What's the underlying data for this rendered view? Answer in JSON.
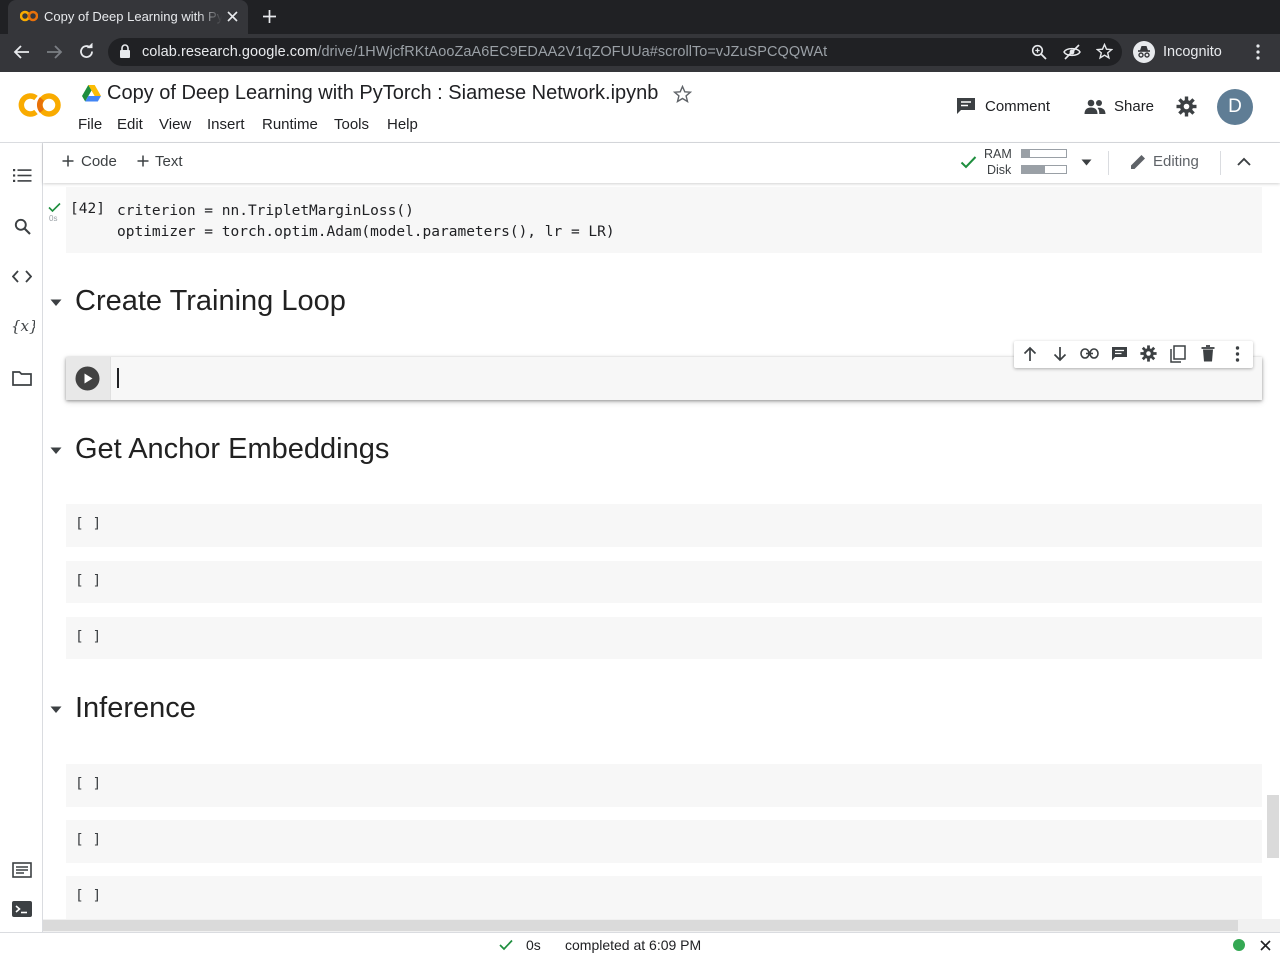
{
  "browser": {
    "tab_title": "Copy of Deep Learning with PyTorch : Siamese Network.ipynb",
    "url_host": "colab.research.google.com",
    "url_path": "/drive/1HWjcfRKtAooZaA6EC9EDAA2V1qZOFUUa#scrollTo=vJZuSPCQQWAt",
    "profile_label": "Incognito"
  },
  "colab": {
    "notebook_title": "Copy of Deep Learning with PyTorch : Siamese Network.ipynb",
    "menu": [
      "File",
      "Edit",
      "View",
      "Insert",
      "Runtime",
      "Tools",
      "Help"
    ],
    "comment_label": "Comment",
    "share_label": "Share",
    "avatar_letter": "D",
    "toolbar": {
      "add_code": "Code",
      "add_text": "Text",
      "ram_label": "RAM",
      "disk_label": "Disk",
      "ram_usage": 0.18,
      "disk_usage": 0.52,
      "editing_label": "Editing"
    }
  },
  "cells": {
    "c42": {
      "exec_count": "[42]",
      "exec_time": "0s",
      "code": "criterion = nn.TripletMarginLoss()\noptimizer = torch.optim.Adam(model.parameters(), lr = LR)"
    },
    "headings": [
      "Create Training Loop",
      "Get Anchor Embeddings",
      "Inference"
    ],
    "empty_prompt": "[ ]"
  },
  "status": {
    "time": "0s",
    "message": "completed at 6:09 PM"
  },
  "colors": {
    "accent_green": "#1e8e3e",
    "colab_orange": "#f9ab00",
    "colab_orange_dark": "#e8710a",
    "connected_dot": "#34a853"
  }
}
